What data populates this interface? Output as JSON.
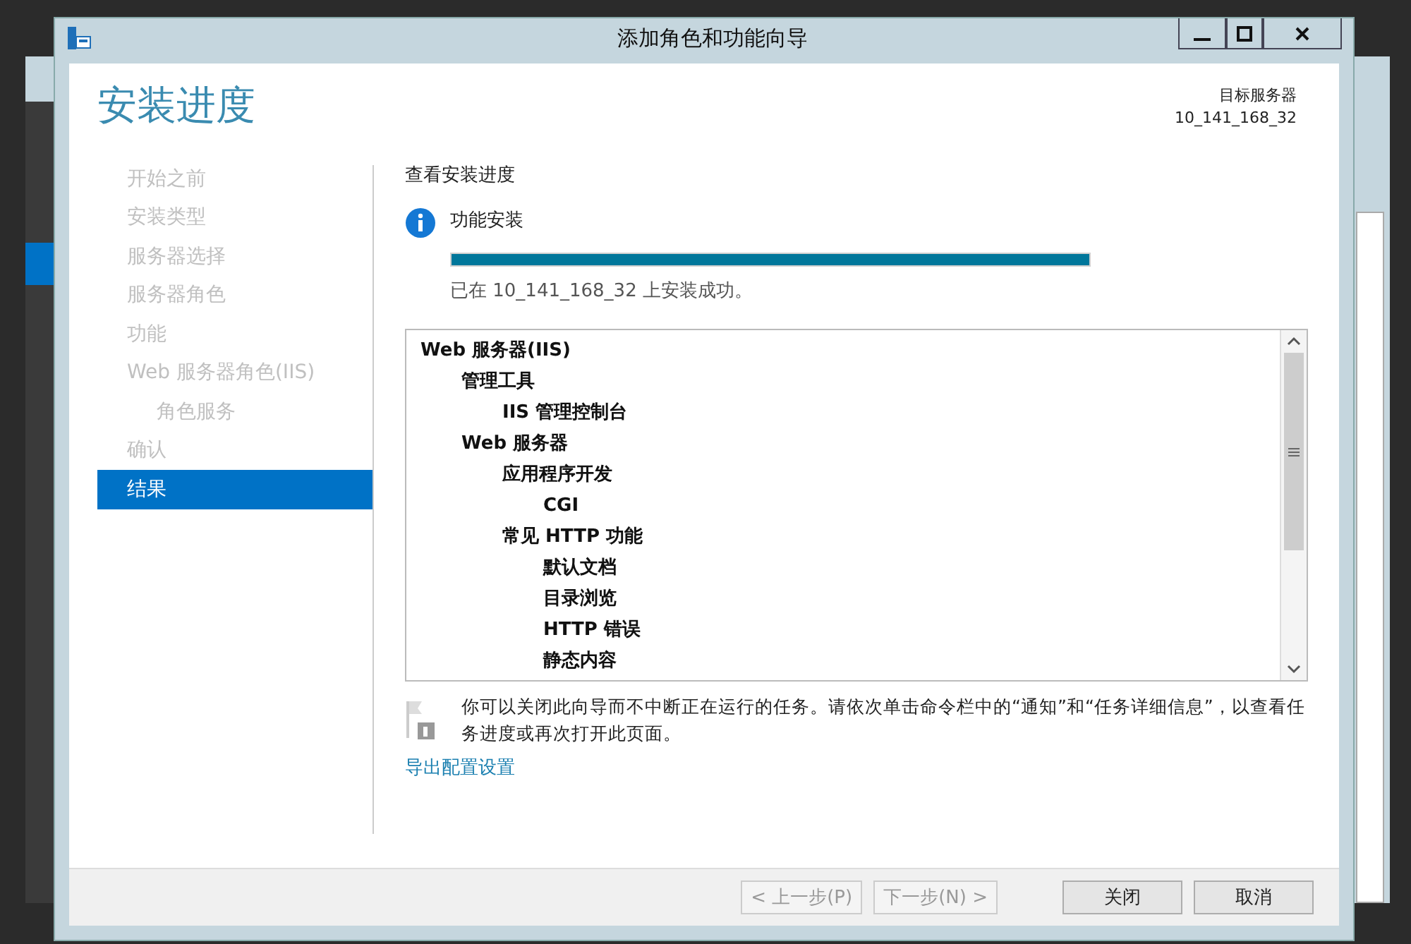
{
  "window": {
    "title": "添加角色和功能向导"
  },
  "header": {
    "title": "安装进度",
    "server_label": "目标服务器",
    "server_name": "10_141_168_32"
  },
  "sidebar": {
    "items": [
      {
        "label": "开始之前",
        "selected": false
      },
      {
        "label": "安装类型",
        "selected": false
      },
      {
        "label": "服务器选择",
        "selected": false
      },
      {
        "label": "服务器角色",
        "selected": false
      },
      {
        "label": "功能",
        "selected": false
      },
      {
        "label": "Web 服务器角色(IIS)",
        "selected": false,
        "children": [
          {
            "label": "角色服务",
            "selected": false
          }
        ]
      },
      {
        "label": "确认",
        "selected": false
      },
      {
        "label": "结果",
        "selected": true
      }
    ]
  },
  "content": {
    "heading": "查看安装进度",
    "status_title": "功能安装",
    "level": 1,
    "status_message": "已在 10_141_168_32 上安装成功。",
    "tree": [
      {
        "label": "Web 服务器(IIS)",
        "children": [
          {
            "label": "管理工具",
            "children": [
              {
                "label": "IIS 管理控制台"
              }
            ]
          },
          {
            "label": "Web 服务器",
            "children": [
              {
                "label": "应用程序开发",
                "children": [
                  {
                    "label": "CGI"
                  }
                ]
              },
              {
                "label": "常见 HTTP 功能",
                "children": [
                  {
                    "label": "默认文档"
                  },
                  {
                    "label": "目录浏览"
                  },
                  {
                    "label": "HTTP 错误"
                  },
                  {
                    "label": "静态内容"
                  }
                ]
              }
            ]
          }
        ]
      }
    ],
    "note": "你可以关闭此向导而不中断正在运行的任务。请依次单击命令栏中的“通知”和“任务详细信息”，以查看任务进度或再次打开此页面。",
    "export_link": "导出配置设置"
  },
  "buttons": [
    {
      "label": "< 上一步(P)",
      "disabled": true
    },
    {
      "label": "下一步(N) >",
      "disabled": true
    },
    {
      "label": "关闭",
      "disabled": false
    },
    {
      "label": "取消",
      "disabled": false
    }
  ]
}
